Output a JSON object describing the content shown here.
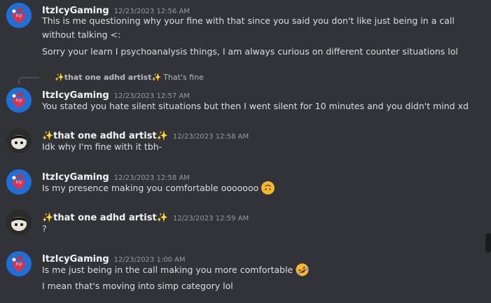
{
  "users": {
    "icy": "ItzIcyGaming",
    "adhd": "✨that one adhd artist✨"
  },
  "messages": [
    {
      "author": "ItzIcyGaming",
      "time": "12/23/2023 12:56 AM",
      "lines": [
        "This is me questioning why your fine with that since you said you don't like just being in a call without talking <:",
        "Sorry your learn I psychoanalysis things, I am always curious on different counter situations lol"
      ]
    },
    {
      "author": "ItzIcyGaming",
      "time": "12/23/2023 12:57 AM",
      "reply": {
        "name": "✨that one adhd artist✨",
        "text": "That's fine"
      },
      "lines": [
        "You stated you hate silent situations but then I went silent for 10 minutes and you didn't mind xd"
      ]
    },
    {
      "author": "✨that one adhd artist✨",
      "time": "12/23/2023 12:58 AM",
      "lines": [
        "Idk why I'm fine with it tbh-"
      ]
    },
    {
      "author": "ItzIcyGaming",
      "time": "12/23/2023 12:58 AM",
      "lines": [
        "Is my presence making you comfortable ooooooo"
      ],
      "emoji": "upside-down-face"
    },
    {
      "author": "✨that one adhd artist✨",
      "time": "12/23/2023 12:59 AM",
      "lines": [
        "?"
      ]
    },
    {
      "author": "ItzIcyGaming",
      "time": "12/23/2023 1:00 AM",
      "lines": [
        "Is me just being in the call making you more comfortable",
        "I mean that's moving into simp category lol"
      ],
      "emoji": "rofl-face"
    }
  ],
  "colors": {
    "background": "#313338",
    "text": "#dbdee1",
    "timestamp": "#949ba4",
    "author": "#f2f3f5",
    "emoji": "#f5b72f"
  }
}
